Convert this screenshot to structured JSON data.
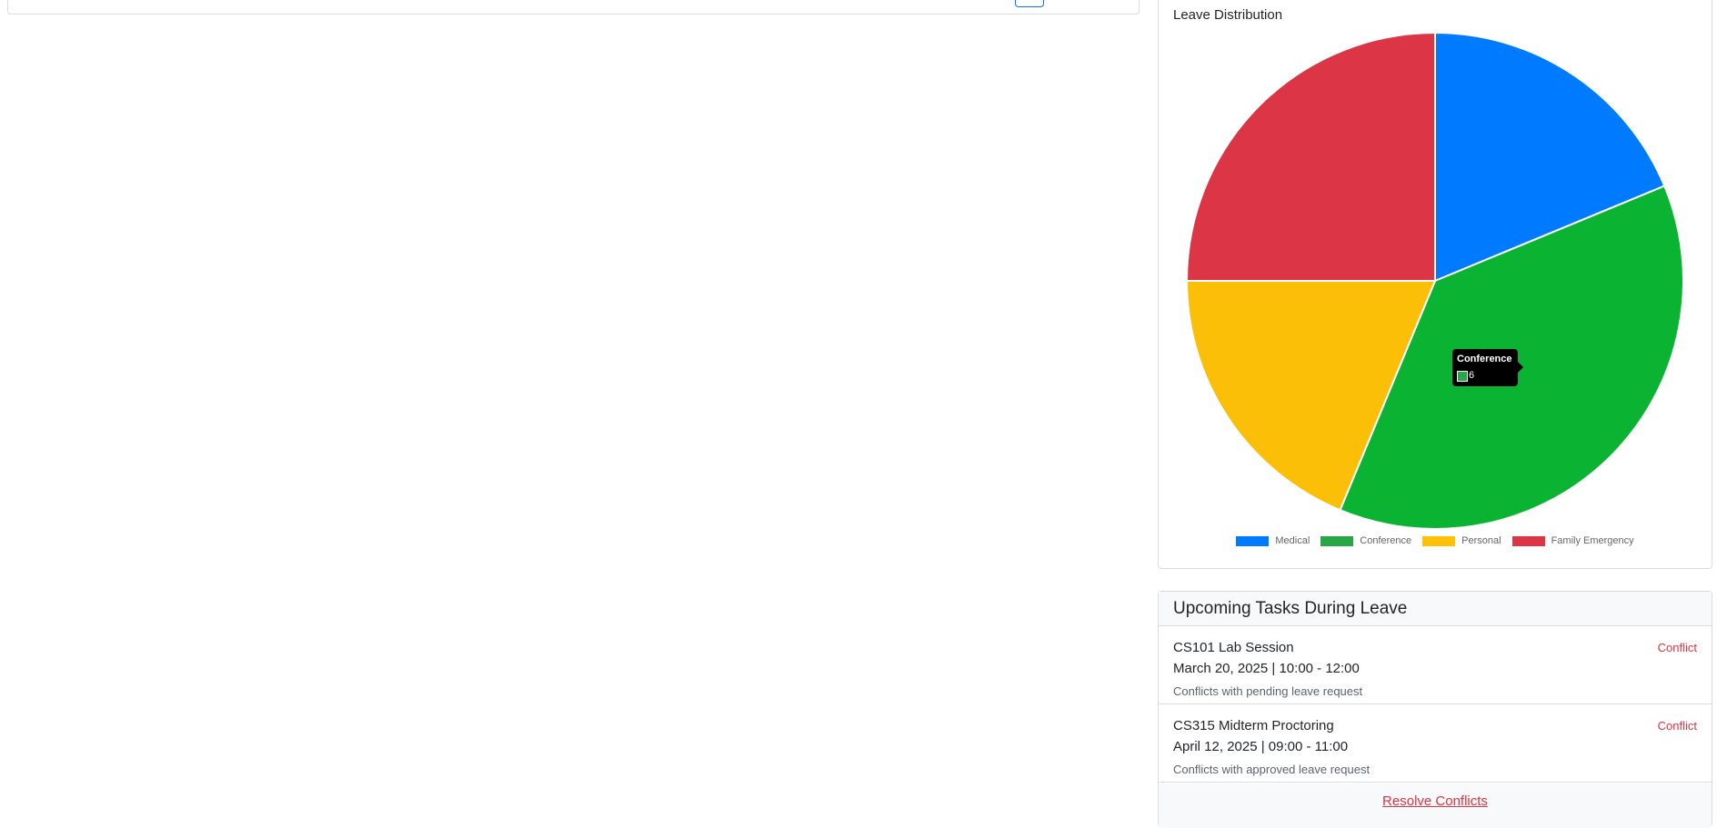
{
  "chart": {
    "title": "Leave Distribution",
    "tooltip": {
      "title": "Conference",
      "value": "6"
    }
  },
  "chart_data": {
    "type": "pie",
    "title": "Leave Distribution",
    "categories": [
      "Medical",
      "Conference",
      "Personal",
      "Family Emergency"
    ],
    "values": [
      3,
      6,
      3,
      4
    ],
    "colors": [
      "#007bff",
      "#0ab332",
      "#fbbf08",
      "#dc3545"
    ],
    "legend": "bottom"
  },
  "legend_colors": [
    "#007bff",
    "#28a745",
    "#ffc107",
    "#dc3545"
  ],
  "tasks": {
    "header": "Upcoming Tasks During Leave",
    "items": [
      {
        "name": "CS101 Lab Session",
        "time": "March 20, 2025 | 10:00 - 12:00",
        "note": "Conflicts with pending leave request",
        "badge": "Conflict"
      },
      {
        "name": "CS315 Midterm Proctoring",
        "time": "April 12, 2025 | 09:00 - 11:00",
        "note": "Conflicts with approved leave request",
        "badge": "Conflict"
      }
    ],
    "footer_link": "Resolve Conflicts"
  }
}
